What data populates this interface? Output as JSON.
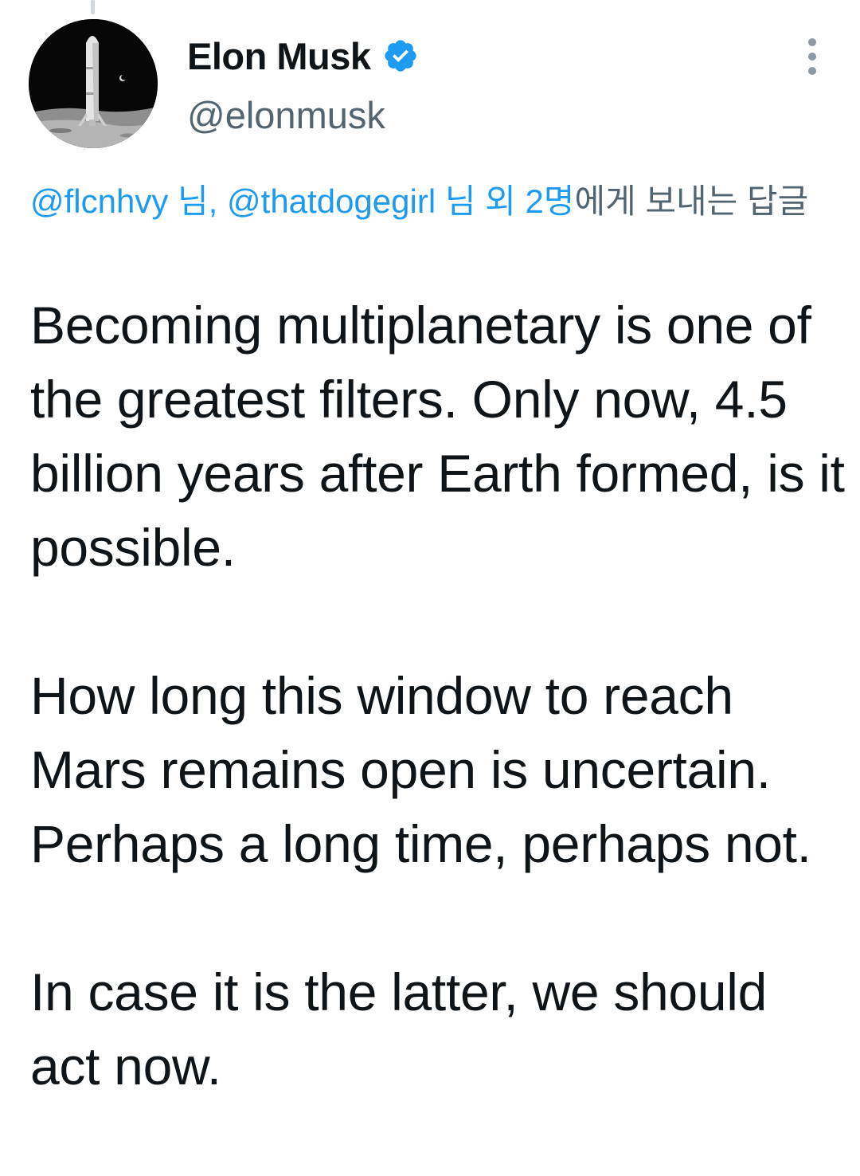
{
  "author": {
    "display_name": "Elon Musk",
    "handle": "@elonmusk",
    "verified": true,
    "avatar_icon": "starship-on-moon-avatar"
  },
  "reply_context": {
    "mention_1": "@flcnhvy",
    "suffix_1": " 님, ",
    "mention_2": "@thatdogegirl",
    "suffix_2": " 님 외 2명",
    "tail": "에게 보내는 답글"
  },
  "tweet": {
    "paragraphs": [
      "Becoming multiplanetary is one of the greatest filters. Only now, 4.5 billion years after Earth formed, is it possible.",
      "How long this window to reach Mars remains open is uncertain. Perhaps a long time, perhaps not.",
      "In case it is the latter, we should act now."
    ]
  },
  "colors": {
    "text": "#0f1419",
    "secondary": "#536471",
    "accent": "#1d9bf0"
  },
  "icons": {
    "verified": "verified-badge-icon",
    "more": "more-options-icon"
  }
}
